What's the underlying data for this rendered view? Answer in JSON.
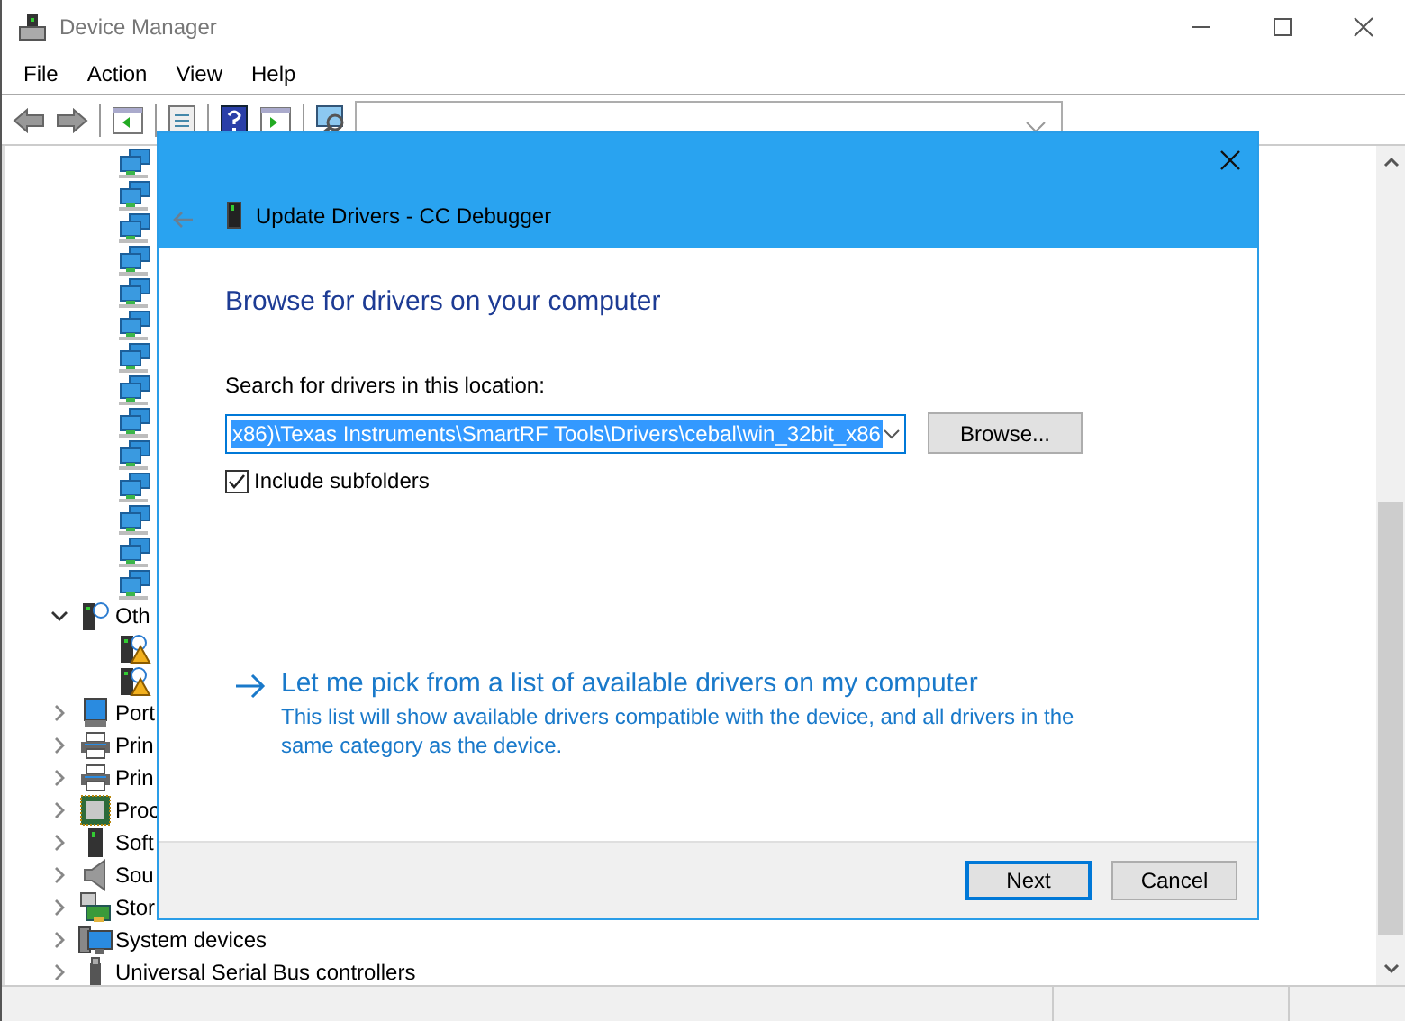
{
  "window": {
    "title": "Device Manager"
  },
  "menu": [
    "File",
    "Action",
    "View",
    "Help"
  ],
  "tree": [
    {
      "kind": "device"
    },
    {
      "kind": "device"
    },
    {
      "kind": "device"
    },
    {
      "kind": "device"
    },
    {
      "kind": "device"
    },
    {
      "kind": "device"
    },
    {
      "kind": "device"
    },
    {
      "kind": "device"
    },
    {
      "kind": "device"
    },
    {
      "kind": "device"
    },
    {
      "kind": "device"
    },
    {
      "kind": "device"
    },
    {
      "kind": "device"
    },
    {
      "kind": "device"
    },
    {
      "kind": "category",
      "label": "Oth",
      "expanded": true,
      "children": [
        {
          "kind": "warning-device"
        },
        {
          "kind": "warning-device"
        }
      ]
    },
    {
      "kind": "category",
      "label": "Port",
      "expanded": false
    },
    {
      "kind": "category",
      "label": "Prin",
      "expanded": false
    },
    {
      "kind": "category",
      "label": "Prin",
      "expanded": false
    },
    {
      "kind": "category",
      "label": "Proc",
      "expanded": false
    },
    {
      "kind": "category",
      "label": "Soft",
      "expanded": false
    },
    {
      "kind": "category",
      "label": "Sou",
      "expanded": false
    },
    {
      "kind": "category",
      "label": "Stor",
      "expanded": false
    },
    {
      "kind": "category",
      "label": "System devices",
      "expanded": false
    },
    {
      "kind": "category",
      "label": "Universal Serial Bus controllers",
      "expanded": false
    }
  ],
  "dialog": {
    "title": "Update Drivers - CC Debugger",
    "heading": "Browse for drivers on your computer",
    "location_label": "Search for drivers in this location:",
    "location": {
      "value": "x86)\\Texas Instruments\\SmartRF Tools\\Drivers\\cebal\\win_32bit_x86",
      "selected": true
    },
    "browse_button": "Browse...",
    "include_subfolders": {
      "label": "Include subfolders",
      "checked": true
    },
    "pick_link": {
      "title": "Let me pick from a list of available drivers on my computer",
      "description": "This list will show available drivers compatible with the device, and all drivers in the same category as the device."
    },
    "buttons": [
      {
        "label": "Next",
        "default": true
      },
      {
        "label": "Cancel",
        "default": false
      }
    ]
  }
}
